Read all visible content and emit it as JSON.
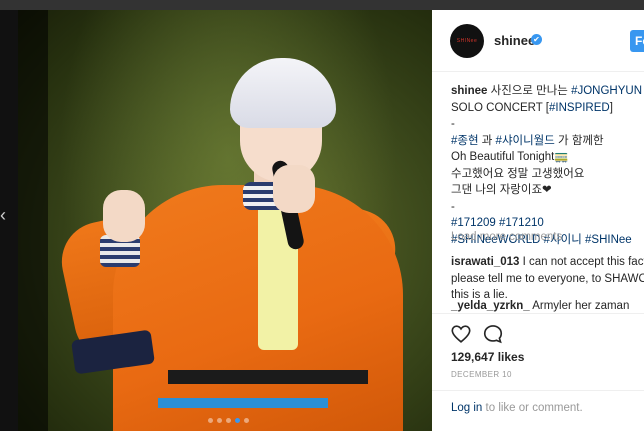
{
  "post": {
    "username": "shinee",
    "verified_mark": "✔",
    "follow_label": "Fo",
    "avatar_text": "SHINee",
    "caption_lines": [
      [
        {
          "t": "shinee",
          "u": true
        },
        {
          "t": " 사진으로 만나는 "
        },
        {
          "t": "#JONGHYUN",
          "tag": true
        }
      ],
      [
        {
          "t": "SOLO CONCERT ["
        },
        {
          "t": "#INSPIRED",
          "tag": true
        },
        {
          "t": "]"
        }
      ],
      [
        {
          "t": "-"
        }
      ],
      [
        {
          "t": "#종현",
          "tag": true
        },
        {
          "t": " 과 "
        },
        {
          "t": "#샤이니월드",
          "tag": true
        },
        {
          "t": " 가 함께한"
        }
      ],
      [
        {
          "t": "Oh Beautiful Tonight🚃"
        }
      ],
      [
        {
          "t": "수고했어요 정말 고생했어요"
        }
      ],
      [
        {
          "t": "그댄 나의 자랑이죠❤"
        }
      ],
      [
        {
          "t": "-"
        }
      ],
      [
        {
          "t": "#171209",
          "tag": true
        },
        {
          "t": " "
        },
        {
          "t": "#171210",
          "tag": true
        }
      ],
      [
        {
          "t": "#SHINeeWORLD",
          "tag": true
        },
        {
          "t": " "
        },
        {
          "t": "#샤이니",
          "tag": true
        },
        {
          "t": " "
        },
        {
          "t": "#SHINee",
          "tag": true
        }
      ]
    ],
    "load_more_label": "Load more comments",
    "comments": [
      {
        "user": "israwati_013",
        "lines": [
          "I can not accept this fact..",
          "please tell me to everyone, to SHAWOL",
          "this is a lie."
        ]
      },
      {
        "user": "_yelda_yzrkn_",
        "lines": [
          "Armyler her zaman"
        ]
      }
    ],
    "likes": "129,647 likes",
    "date": "DECEMBER 10",
    "login_link": "Log in",
    "login_rest": " to like or comment."
  },
  "icons": {
    "heart": "heart-icon",
    "comment": "comment-icon",
    "left_arrow": "chevron-left-icon",
    "verified": "verified-badge-icon"
  },
  "colors": {
    "accent": "#3897f0",
    "hashtag": "#003569",
    "muted": "#999999"
  },
  "carousel": {
    "count": 5,
    "active": 3
  }
}
